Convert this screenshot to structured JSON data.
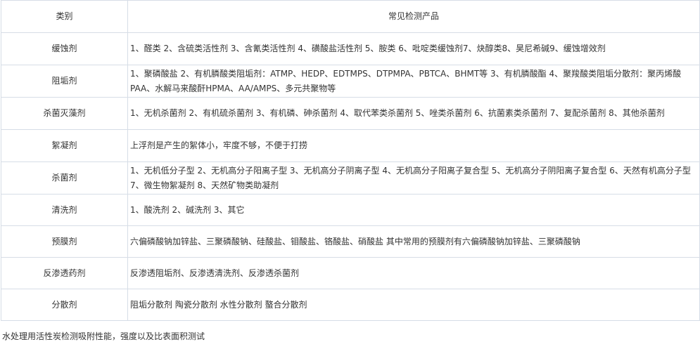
{
  "header": {
    "col1": "类别",
    "col2": "常见检测产品"
  },
  "rows": [
    {
      "category": "缓蚀剂",
      "products": "1、醛类 2、含硫类活性剂 3、含氰类活性剂 4、磺酸盐活性剂 5、胺类 6、吡啶类缓蚀剂7、炔醇类8、昊尼希碱9、缓蚀增效剂"
    },
    {
      "category": "阻垢剂",
      "products": "1、聚磷酸盐 2、有机膦酸类阻垢剂：ATMP、HEDP、EDTMPS、DTPMPA、PBTCA、BHMT等 3、有机膦酸酯 4、聚羧酸类阻垢分散剂：聚丙烯酸PAA、水解马来酸酐HPMA、AA/AMPS、多元共聚物等"
    },
    {
      "category": "杀菌灭藻剂",
      "products": "1、无机杀菌剂  2、有机硫杀菌剂  3、有机磷、砷杀菌剂  4、取代苯类杀菌剂 5、唑类杀菌剂  6、抗菌素类杀菌剂  7、复配杀菌剂  8、其他杀菌剂"
    },
    {
      "category": "絮凝剂",
      "products": "上浮剂是产生的絮体小，牢度不够，不便于打捞"
    },
    {
      "category": "杀菌剂",
      "products": "1、无机低分子型  2、无机高分子阳离子型  3、无机高分子阴离子型 4、无机高分子阳离子复合型  5、无机高分子阴阳离子复合型  6、天然有机高分子型  7、微生物絮凝剂  8、天然矿物类助凝剂"
    },
    {
      "category": "清洗剂",
      "products": "1、酸洗剂    2、碱洗剂    3、其它"
    },
    {
      "category": "预膜剂",
      "products": "六偏磷酸钠加锌盐、三聚磷酸钠、硅酸盐、钼酸盐、铬酸盐、硝酸盐 其中常用的预膜剂有六偏磷酸钠加锌盐、三聚磷酸钠"
    },
    {
      "category": "反渗透药剂",
      "products": "反渗透阻垢剂、反渗透清洗剂、反渗透杀菌剂"
    },
    {
      "category": "分散剂",
      "products": "阻垢分散剂 陶瓷分散剂 水性分散剂 螯合分散剂"
    }
  ],
  "footer_note": "水处理用活性炭检测吸附性能，强度以及比表面积测试",
  "colors": {
    "border": "#d6dde6",
    "text": "#333333"
  }
}
